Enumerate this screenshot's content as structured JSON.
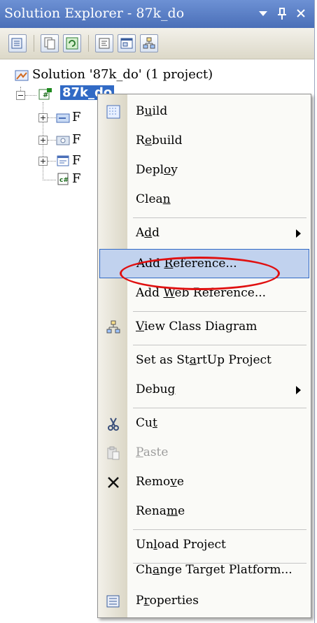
{
  "window": {
    "title": "Solution Explorer - 87k_do",
    "buttons": {
      "dropdown": "▾",
      "pin": "ᵖ",
      "close": "✕"
    }
  },
  "toolbar": {
    "icons": [
      "properties-icon",
      "show-all-files-icon",
      "refresh-icon",
      "view-code-icon",
      "view-designer-icon",
      "view-class-diagram-icon"
    ]
  },
  "tree": {
    "solution": "Solution '87k_do' (1 project)",
    "project": "87k_do",
    "children": [
      {
        "label": "F",
        "icon": "properties-folder-icon",
        "expandable": true
      },
      {
        "label": "F",
        "icon": "references-folder-icon",
        "expandable": true
      },
      {
        "label": "F",
        "icon": "form-icon",
        "expandable": true
      },
      {
        "label": "F",
        "icon": "csharp-file-icon",
        "expandable": false
      }
    ]
  },
  "context_menu": {
    "items": [
      {
        "pre": "B",
        "u": "u",
        "post": "ild",
        "icon": "build-icon"
      },
      {
        "pre": "R",
        "u": "e",
        "post": "build"
      },
      {
        "pre": "Depl",
        "u": "o",
        "post": "y"
      },
      {
        "pre": "Clea",
        "u": "n",
        "post": ""
      },
      {
        "pre": "A",
        "u": "d",
        "post": "d",
        "submenu": true
      },
      {
        "pre": "Add ",
        "u": "R",
        "post": "eference...",
        "highlighted": true
      },
      {
        "pre": "Add ",
        "u": "W",
        "post": "eb Reference..."
      },
      {
        "pre": "",
        "u": "V",
        "post": "iew Class Diagram",
        "icon": "class-diagram-icon"
      },
      {
        "pre": "Set as St",
        "u": "a",
        "post": "rtUp Project"
      },
      {
        "pre": "Debu",
        "u": "g",
        "post": "",
        "submenu": true
      },
      {
        "pre": "Cu",
        "u": "t",
        "post": "",
        "icon": "scissors-icon"
      },
      {
        "pre": "",
        "u": "P",
        "post": "aste",
        "icon": "paste-icon",
        "disabled": true
      },
      {
        "pre": "Remo",
        "u": "v",
        "post": "e",
        "icon": "delete-x-icon"
      },
      {
        "pre": "Rena",
        "u": "m",
        "post": "e"
      },
      {
        "pre": "Un",
        "u": "l",
        "post": "oad Project"
      },
      {
        "pre": "Ch",
        "u": "a",
        "post": "nge Target Platform..."
      },
      {
        "pre": "P",
        "u": "r",
        "post": "operties",
        "icon": "properties-icon"
      }
    ]
  },
  "colors": {
    "accent": "#316ac5",
    "annotation": "#e01010",
    "highlight": "#c1d2ee"
  }
}
